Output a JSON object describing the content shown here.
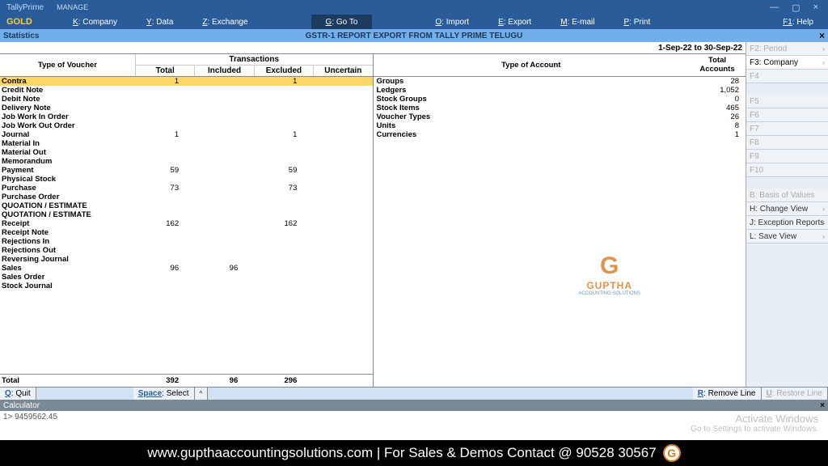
{
  "app": {
    "name": "TallyPrime",
    "edition": "GOLD",
    "manage": "MANAGE"
  },
  "window": {
    "min": "—",
    "max": "▢",
    "close": "×"
  },
  "menu": {
    "company": {
      "key": "K",
      "label": ": Company"
    },
    "data": {
      "key": "Y",
      "label": ": Data"
    },
    "exchange": {
      "key": "Z",
      "label": ": Exchange"
    },
    "goto": {
      "key": "G",
      "label": ": Go To"
    },
    "import": {
      "key": "O",
      "label": ": Import"
    },
    "export": {
      "key": "E",
      "label": ": Export"
    },
    "email": {
      "key": "M",
      "label": ": E-mail"
    },
    "print": {
      "key": "P",
      "label": ": Print"
    },
    "help": {
      "key": "F1",
      "label": ": Help"
    }
  },
  "title": {
    "stats": "Statistics",
    "report": "GSTR-1 REPORT EXPORT FROM TALLY PRIME TELUGU",
    "period": "1-Sep-22 to 30-Sep-22",
    "close": "×"
  },
  "headers": {
    "voucher_type": "Type of Voucher",
    "transactions": "Transactions",
    "total": "Total",
    "included": "Included",
    "excluded": "Excluded",
    "uncertain": "Uncertain",
    "account_type": "Type of Account",
    "total_accounts_l1": "Total",
    "total_accounts_l2": "Accounts"
  },
  "vouchers": [
    {
      "name": "Contra",
      "total": "1",
      "included": "",
      "excluded": "1",
      "uncertain": "",
      "selected": true
    },
    {
      "name": "Credit Note",
      "total": "",
      "included": "",
      "excluded": "",
      "uncertain": ""
    },
    {
      "name": "Debit Note",
      "total": "",
      "included": "",
      "excluded": "",
      "uncertain": ""
    },
    {
      "name": "Delivery Note",
      "total": "",
      "included": "",
      "excluded": "",
      "uncertain": ""
    },
    {
      "name": "Job Work In Order",
      "total": "",
      "included": "",
      "excluded": "",
      "uncertain": ""
    },
    {
      "name": "Job Work Out Order",
      "total": "",
      "included": "",
      "excluded": "",
      "uncertain": ""
    },
    {
      "name": "Journal",
      "total": "1",
      "included": "",
      "excluded": "1",
      "uncertain": ""
    },
    {
      "name": "Material In",
      "total": "",
      "included": "",
      "excluded": "",
      "uncertain": ""
    },
    {
      "name": "Material Out",
      "total": "",
      "included": "",
      "excluded": "",
      "uncertain": ""
    },
    {
      "name": "Memorandum",
      "total": "",
      "included": "",
      "excluded": "",
      "uncertain": ""
    },
    {
      "name": "Payment",
      "total": "59",
      "included": "",
      "excluded": "59",
      "uncertain": ""
    },
    {
      "name": "Physical Stock",
      "total": "",
      "included": "",
      "excluded": "",
      "uncertain": ""
    },
    {
      "name": "Purchase",
      "total": "73",
      "included": "",
      "excluded": "73",
      "uncertain": ""
    },
    {
      "name": "Purchase Order",
      "total": "",
      "included": "",
      "excluded": "",
      "uncertain": ""
    },
    {
      "name": "QUOATION / ESTIMATE",
      "total": "",
      "included": "",
      "excluded": "",
      "uncertain": ""
    },
    {
      "name": "QUOTATION / ESTIMATE",
      "total": "",
      "included": "",
      "excluded": "",
      "uncertain": ""
    },
    {
      "name": "Receipt",
      "total": "162",
      "included": "",
      "excluded": "162",
      "uncertain": ""
    },
    {
      "name": "Receipt Note",
      "total": "",
      "included": "",
      "excluded": "",
      "uncertain": ""
    },
    {
      "name": "Rejections In",
      "total": "",
      "included": "",
      "excluded": "",
      "uncertain": ""
    },
    {
      "name": "Rejections Out",
      "total": "",
      "included": "",
      "excluded": "",
      "uncertain": ""
    },
    {
      "name": "Reversing Journal",
      "total": "",
      "included": "",
      "excluded": "",
      "uncertain": ""
    },
    {
      "name": "Sales",
      "total": "96",
      "included": "96",
      "excluded": "",
      "uncertain": ""
    },
    {
      "name": "Sales Order",
      "total": "",
      "included": "",
      "excluded": "",
      "uncertain": ""
    },
    {
      "name": "Stock Journal",
      "total": "",
      "included": "",
      "excluded": "",
      "uncertain": ""
    }
  ],
  "totals": {
    "label": "Total",
    "total": "392",
    "included": "96",
    "excluded": "296",
    "uncertain": ""
  },
  "accounts": [
    {
      "name": "Groups",
      "val": "28"
    },
    {
      "name": "Ledgers",
      "val": "1,052"
    },
    {
      "name": "Stock Groups",
      "val": "0"
    },
    {
      "name": "Stock Items",
      "val": "465"
    },
    {
      "name": "Voucher Types",
      "val": "26"
    },
    {
      "name": "Units",
      "val": "8"
    },
    {
      "name": "Currencies",
      "val": "1"
    }
  ],
  "rpanel": {
    "f2": "F2: Period",
    "f3": "F3: Company",
    "f4": "F4",
    "f5": "F5",
    "f6": "F6",
    "f7": "F7",
    "f8": "F8",
    "f9": "F9",
    "f10": "F10",
    "basis": "B: Basis of Values",
    "change": "H: Change View",
    "exception": "J: Exception Reports",
    "save": "L: Save View"
  },
  "actions": {
    "quit": {
      "key": "Q",
      "label": ": Quit"
    },
    "space": {
      "key": "Space",
      "label": ": Select"
    },
    "caret": "^",
    "remove": {
      "key": "R",
      "label": ": Remove Line"
    },
    "restore": {
      "key": "U",
      "label": ": Restore Line"
    }
  },
  "calculator": {
    "label": "Calculator",
    "close": "×",
    "line1": "1>  9459562.45"
  },
  "activate": {
    "l1": "Activate Windows",
    "l2": "Go to Settings to activate Windows."
  },
  "banner": {
    "text": "www.gupthaaccountingsolutions.com | For Sales & Demos Contact @ 90528 30567",
    "logo": "G"
  },
  "watermark": {
    "g": "G",
    "txt": "GUPTHA",
    "sub": "ACCOUNTING SOLUTIONS"
  }
}
